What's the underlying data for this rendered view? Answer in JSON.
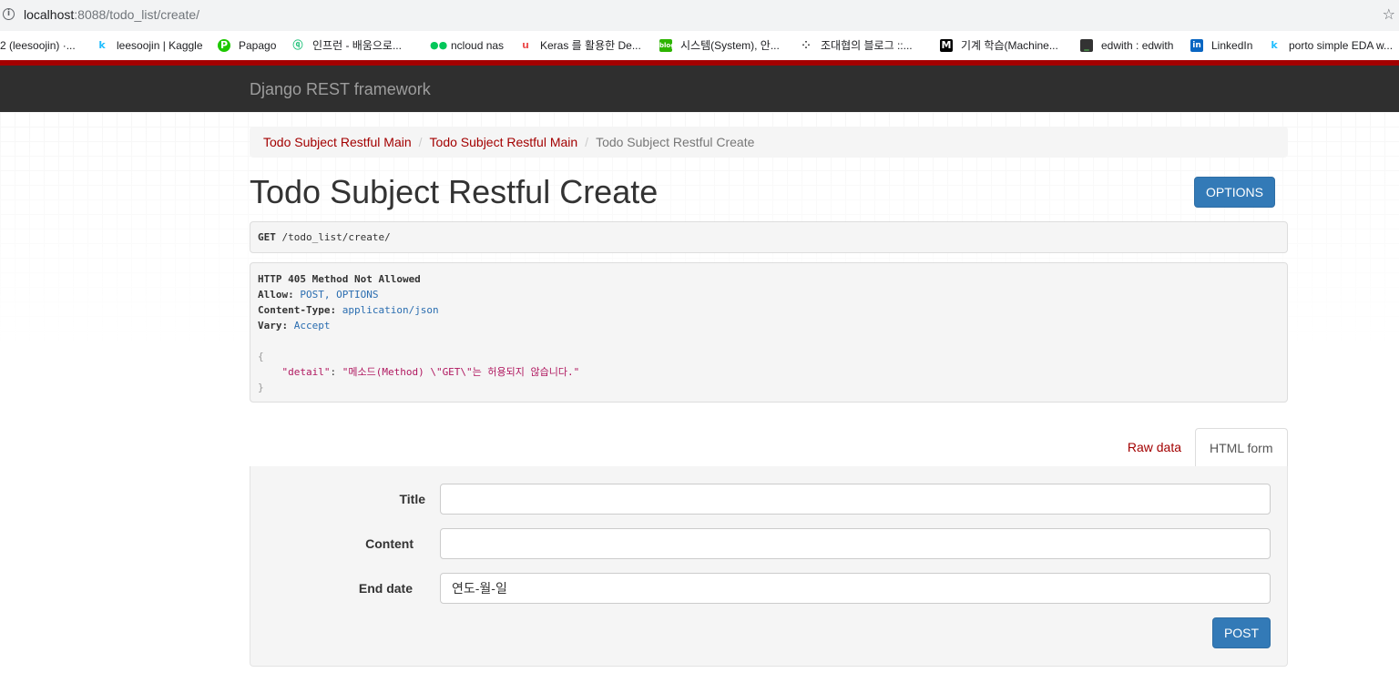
{
  "browser": {
    "url_host": "localhost",
    "url_rest": ":8088/todo_list/create/",
    "bookmarks": [
      {
        "label": "2 (leesoojin) ·...",
        "icon": "none"
      },
      {
        "label": "leesoojin | Kaggle",
        "icon": "kaggle-k",
        "glyph": "k",
        "color": "#20beff"
      },
      {
        "label": "Papago",
        "icon": "papago",
        "glyph": "P",
        "color": "#1ec800"
      },
      {
        "label": "인프런 - 배움으로...",
        "icon": "inflearn",
        "glyph": "Q",
        "color": "#1dc078"
      },
      {
        "label": "ncloud nas",
        "icon": "ncloud",
        "glyph": "■",
        "color": "#03c75a"
      },
      {
        "label": "Keras 를 활용한 De...",
        "icon": "udemy",
        "glyph": "u",
        "color": "#ec5252"
      },
      {
        "label": "시스템(System), 안...",
        "icon": "blog",
        "glyph": "b",
        "color": "#2db400"
      },
      {
        "label": "조대협의 블로그 ::...",
        "icon": "tistory",
        "glyph": "⁘",
        "color": "#333333"
      },
      {
        "label": "기계 학습(Machine...",
        "icon": "medium",
        "glyph": "M",
        "color": "#000000"
      },
      {
        "label": "edwith : edwith",
        "icon": "edwith",
        "glyph": "_",
        "color": "#333333"
      },
      {
        "label": "LinkedIn",
        "icon": "linkedin",
        "glyph": "in",
        "color": "#0a66c2"
      },
      {
        "label": "porto simple EDA w...",
        "icon": "kaggle-k",
        "glyph": "k",
        "color": "#20beff"
      }
    ]
  },
  "navbar": {
    "brand": "Django REST framework"
  },
  "breadcrumb": {
    "items": [
      "Todo Subject Restful Main",
      "Todo Subject Restful Main"
    ],
    "active": "Todo Subject Restful Create",
    "sep": "/"
  },
  "page": {
    "title": "Todo Subject Restful Create",
    "options_label": "OPTIONS"
  },
  "request": {
    "method": "GET",
    "path": "/todo_list/create/"
  },
  "response": {
    "status": "HTTP 405 Method Not Allowed",
    "headers": [
      {
        "name": "Allow:",
        "value": "POST, OPTIONS"
      },
      {
        "name": "Content-Type:",
        "value": "application/json"
      },
      {
        "name": "Vary:",
        "value": "Accept"
      }
    ],
    "open_brace": "{",
    "close_brace": "}",
    "body_key": "\"detail\"",
    "body_colon": ": ",
    "body_value": "\"메소드(Method) \\\"GET\\\"는 허용되지 않습니다.\""
  },
  "tabs": {
    "raw": "Raw data",
    "html": "HTML form"
  },
  "form": {
    "fields": [
      {
        "label": "Title",
        "value": ""
      },
      {
        "label": "Content",
        "value": ""
      },
      {
        "label": "End date",
        "value": "연도-월-일"
      }
    ],
    "submit": "POST"
  },
  "colors": {
    "accent": "#a30000",
    "primary": "#337ab7",
    "navbar": "#2f2f2f"
  }
}
